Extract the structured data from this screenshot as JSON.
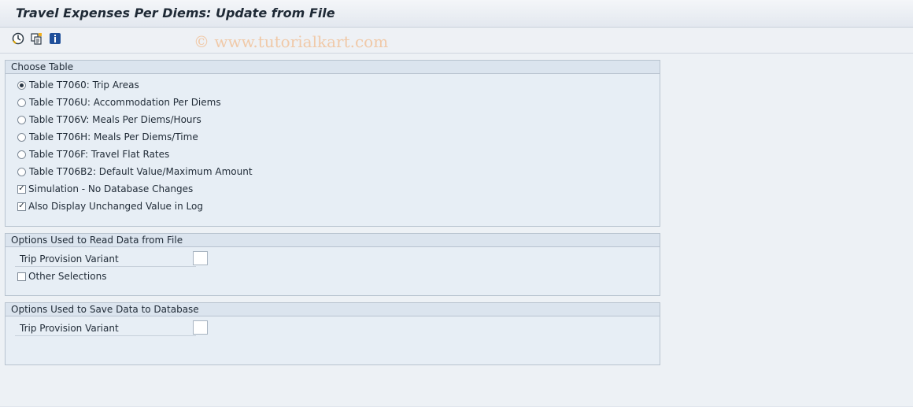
{
  "window": {
    "title": "Travel Expenses Per Diems: Update from File"
  },
  "toolbar": {
    "watermark": "© www.tutorialkart.com",
    "buttons": [
      {
        "icon": "execute-icon"
      },
      {
        "icon": "copy-variant-icon"
      },
      {
        "icon": "info-icon"
      }
    ]
  },
  "choose_table": {
    "title": "Choose Table",
    "options": [
      {
        "label": "Table T7060: Trip Areas",
        "selected": true
      },
      {
        "label": "Table T706U: Accommodation Per Diems",
        "selected": false
      },
      {
        "label": "Table T706V: Meals Per Diems/Hours",
        "selected": false
      },
      {
        "label": "Table T706H: Meals Per Diems/Time",
        "selected": false
      },
      {
        "label": "Table T706F: Travel Flat Rates",
        "selected": false
      },
      {
        "label": "Table T706B2: Default Value/Maximum Amount",
        "selected": false
      }
    ],
    "checks": [
      {
        "label": "Simulation - No Database Changes",
        "checked": true
      },
      {
        "label": "Also Display Unchanged Value in Log",
        "checked": true
      }
    ]
  },
  "read_options": {
    "title": "Options Used to Read Data from File",
    "trip_variant_label": "Trip Provision Variant",
    "trip_variant_value": "",
    "other_selections_label": "Other Selections"
  },
  "save_options": {
    "title": "Options Used to Save Data to Database",
    "trip_variant_label": "Trip Provision Variant",
    "trip_variant_value": ""
  }
}
